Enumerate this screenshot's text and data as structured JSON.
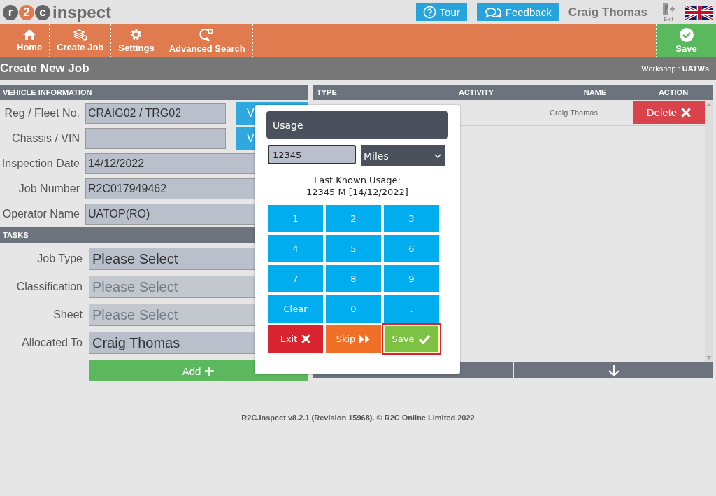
{
  "header": {
    "logo_letters": [
      "r",
      "2",
      "c"
    ],
    "logo_word": "inspect",
    "buttons": [
      {
        "label": "Tour"
      },
      {
        "label": "Feedback"
      }
    ],
    "user": "Craig Thomas",
    "exit_label": "Exit"
  },
  "nav": {
    "items": [
      {
        "label": "Home"
      },
      {
        "label": "Create Job"
      },
      {
        "label": "Settings"
      },
      {
        "label": "Advanced Search"
      }
    ],
    "save": "Save"
  },
  "page": {
    "title": "Create New Job",
    "workshop": "Workshop : **UATWs**"
  },
  "vehicle": {
    "heading": "VEHICLE INFORMATION",
    "fields": [
      {
        "label": "Reg / Fleet No.",
        "value": "CRAIG02 / TRG02",
        "button": "V"
      },
      {
        "label": "Chassis / VIN",
        "button": "V"
      },
      {
        "label": "Inspection Date",
        "value": "14/12/2022"
      },
      {
        "label": "Job Number",
        "value": "R2C017949462"
      },
      {
        "label": "Operator Name",
        "value": "UATOP(RO)"
      }
    ]
  },
  "tasks": {
    "heading": "TASKS",
    "fields": [
      {
        "label": "Job Type",
        "value": "Please Select",
        "disabled": false
      },
      {
        "label": "Classification",
        "value": "Please Select",
        "disabled": true
      },
      {
        "label": "Sheet",
        "value": "Please Select",
        "disabled": true
      },
      {
        "label": "Allocated To",
        "value": "Craig Thomas",
        "disabled": false
      }
    ],
    "add_button": "Add"
  },
  "table": {
    "columns": [
      "TYPE",
      "ACTIVITY",
      "NAME",
      "ACTION"
    ],
    "rows": [
      {
        "name": "Craig Thomas",
        "action": "Delete"
      }
    ]
  },
  "usage_dialog": {
    "title": "Usage",
    "value": "12345",
    "unit": "Miles",
    "last_known": "Last Known Usage:",
    "last_value": "12345 M [14/12/2022]",
    "keys": [
      "1",
      "2",
      "3",
      "4",
      "5",
      "6",
      "7",
      "8",
      "9",
      "Clear",
      "0",
      "."
    ],
    "actions": [
      {
        "label": "Exit",
        "kind": "exit",
        "selected": false
      },
      {
        "label": "Skip",
        "kind": "skip",
        "selected": false
      },
      {
        "label": "Save",
        "kind": "save",
        "selected": true
      }
    ]
  },
  "footer": "R2C.Inspect v8.2.1 (Revision 15968). © R2C Online Limited 2022"
}
